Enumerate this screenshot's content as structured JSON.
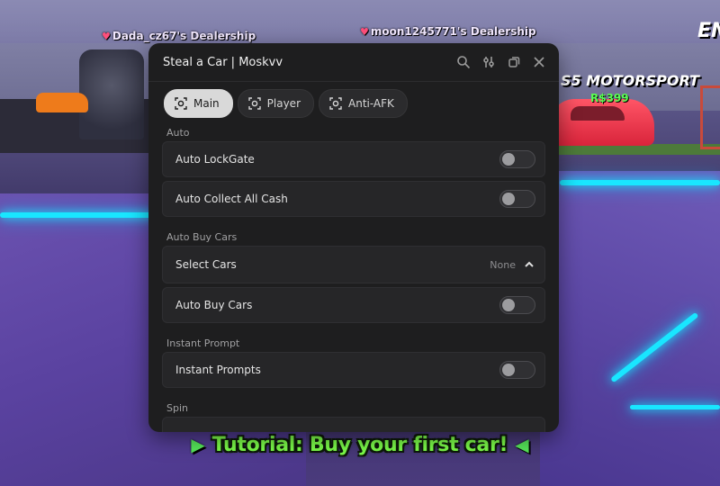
{
  "background": {
    "signs": [
      {
        "text": "Dada_cz67's Dealership"
      },
      {
        "text": "moon1245771's Dealership"
      }
    ],
    "dealer_banner": "S5 MOTORSPORT",
    "price": "R$399",
    "corner_text": "EN"
  },
  "tutorial": {
    "text": "Tutorial: Buy your first car!"
  },
  "window": {
    "title": "Steal a Car | Moskvv",
    "actions": [
      "search-icon",
      "settings-sliders-icon",
      "minimize-icon",
      "close-icon"
    ],
    "tabs": [
      {
        "label": "Main",
        "active": true
      },
      {
        "label": "Player",
        "active": false
      },
      {
        "label": "Anti-AFK",
        "active": false
      }
    ],
    "sections": {
      "auto": {
        "title": "Auto",
        "rows": [
          {
            "label": "Auto LockGate",
            "on": false
          },
          {
            "label": "Auto Collect All Cash",
            "on": false
          }
        ]
      },
      "auto_buy": {
        "title": "Auto Buy Cars",
        "select": {
          "label": "Select Cars",
          "value": "None"
        },
        "rows": [
          {
            "label": "Auto Buy Cars",
            "on": false
          }
        ]
      },
      "instant": {
        "title": "Instant Prompt",
        "rows": [
          {
            "label": "Instant Prompts",
            "on": false
          }
        ]
      },
      "spin": {
        "title": "Spin"
      }
    }
  }
}
